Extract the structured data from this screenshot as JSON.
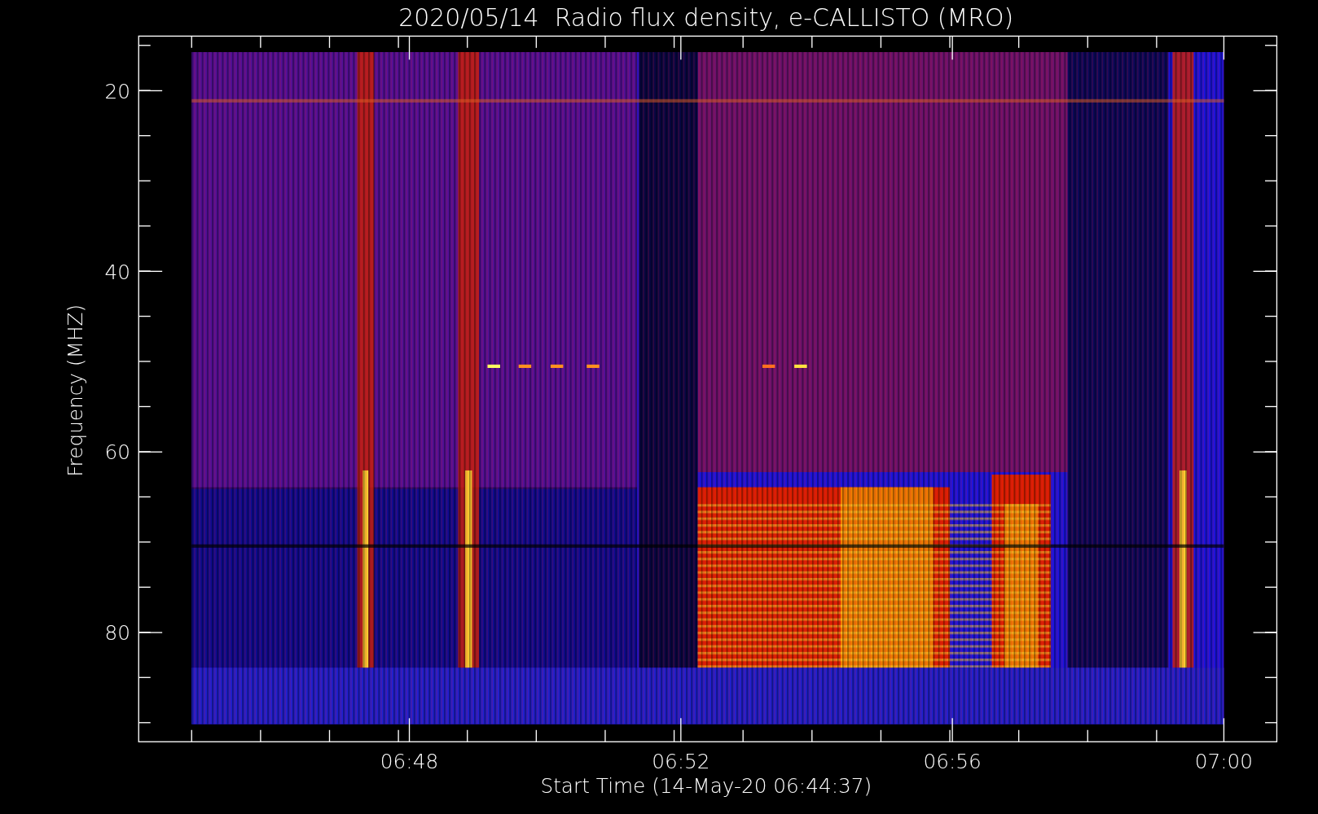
{
  "title": "2020/05/14  Radio flux density, e-CALLISTO (MRO)",
  "x_axis": {
    "label": "Start Time (14-May-20 06:44:37)",
    "ticks": [
      "06:48",
      "06:52",
      "06:56",
      "07:00"
    ]
  },
  "y_axis": {
    "label": "Frequency (MHZ)",
    "ticks": [
      "20",
      "40",
      "60",
      "80"
    ]
  }
}
